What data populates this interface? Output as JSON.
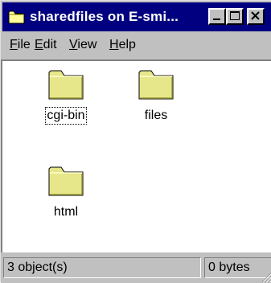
{
  "window": {
    "title": "sharedfiles on E-smi...",
    "title_bar_color": "#000080",
    "controls": [
      "minimize-icon",
      "maximize-icon",
      "close-icon"
    ]
  },
  "menu": {
    "items": [
      {
        "label_underlined": "F",
        "label_rest": "ile"
      },
      {
        "label_underlined": "E",
        "label_rest": "dit"
      },
      {
        "label_underlined": "V",
        "label_rest": "iew"
      },
      {
        "label_underlined": "H",
        "label_rest": "elp"
      }
    ]
  },
  "folders": [
    {
      "name": "cgi-bin",
      "icon": "folder-icon",
      "focused": true
    },
    {
      "name": "files",
      "icon": "folder-icon",
      "focused": false
    },
    {
      "name": "html",
      "icon": "folder-icon",
      "focused": false
    }
  ],
  "status": {
    "objects": "3 object(s)",
    "size": "0 bytes"
  }
}
